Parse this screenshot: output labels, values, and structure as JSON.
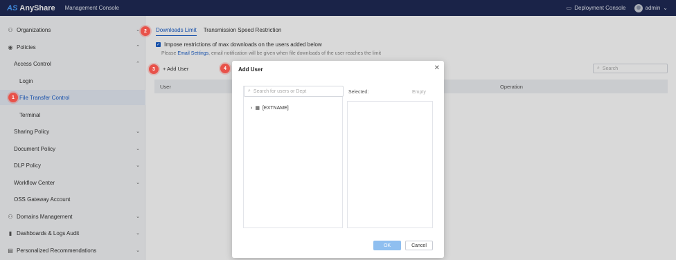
{
  "topbar": {
    "logo_mark": "AS",
    "logo_text": "AnyShare",
    "title": "Management Console",
    "deployment": "Deployment Console",
    "user": "admin"
  },
  "sidebar": {
    "items": [
      {
        "label": "Organizations",
        "icon": "org-icon",
        "chev": "⌄"
      },
      {
        "label": "Policies",
        "icon": "policy-icon",
        "chev": "⌃"
      },
      {
        "label": "Access Control",
        "chev": "⌃"
      },
      {
        "label": "Login"
      },
      {
        "label": "File Transfer Control"
      },
      {
        "label": "Terminal"
      },
      {
        "label": "Sharing Policy",
        "chev": "⌄"
      },
      {
        "label": "Document Policy",
        "chev": "⌄"
      },
      {
        "label": "DLP Policy",
        "chev": "⌄"
      },
      {
        "label": "Workflow Center",
        "chev": "⌄"
      },
      {
        "label": "OSS Gateway Account"
      },
      {
        "label": "Domains Management",
        "icon": "domain-icon",
        "chev": "⌄"
      },
      {
        "label": "Dashboards & Logs Audit",
        "icon": "dashboard-icon",
        "chev": "⌄"
      },
      {
        "label": "Personalized Recommendations",
        "icon": "recommend-icon",
        "chev": "⌄"
      }
    ]
  },
  "main": {
    "tabs": [
      "Downloads Limit",
      "Transmission Speed Restriction"
    ],
    "checkbox_label": "Impose restrictions of max downloads on the users added below",
    "note_prefix": "Please ",
    "note_link": "Email Settings",
    "note_suffix": ", email notification will be given when file downloads of the user reaches the limit",
    "add_user": "+ Add User",
    "search_placeholder": "Search",
    "columns": {
      "user": "User",
      "operation": "Operation"
    }
  },
  "modal": {
    "title": "Add User",
    "search_placeholder": "Search for users or Dept",
    "tree_root": "[EXTNAME]",
    "selected": "Selected:",
    "empty": "Empty",
    "ok": "OK",
    "cancel": "Cancel"
  },
  "badges": [
    "1",
    "2",
    "3",
    "4"
  ],
  "colors": {
    "accent": "#1a5ec8",
    "topbar": "#1f2a55",
    "badge": "#e8524a"
  }
}
